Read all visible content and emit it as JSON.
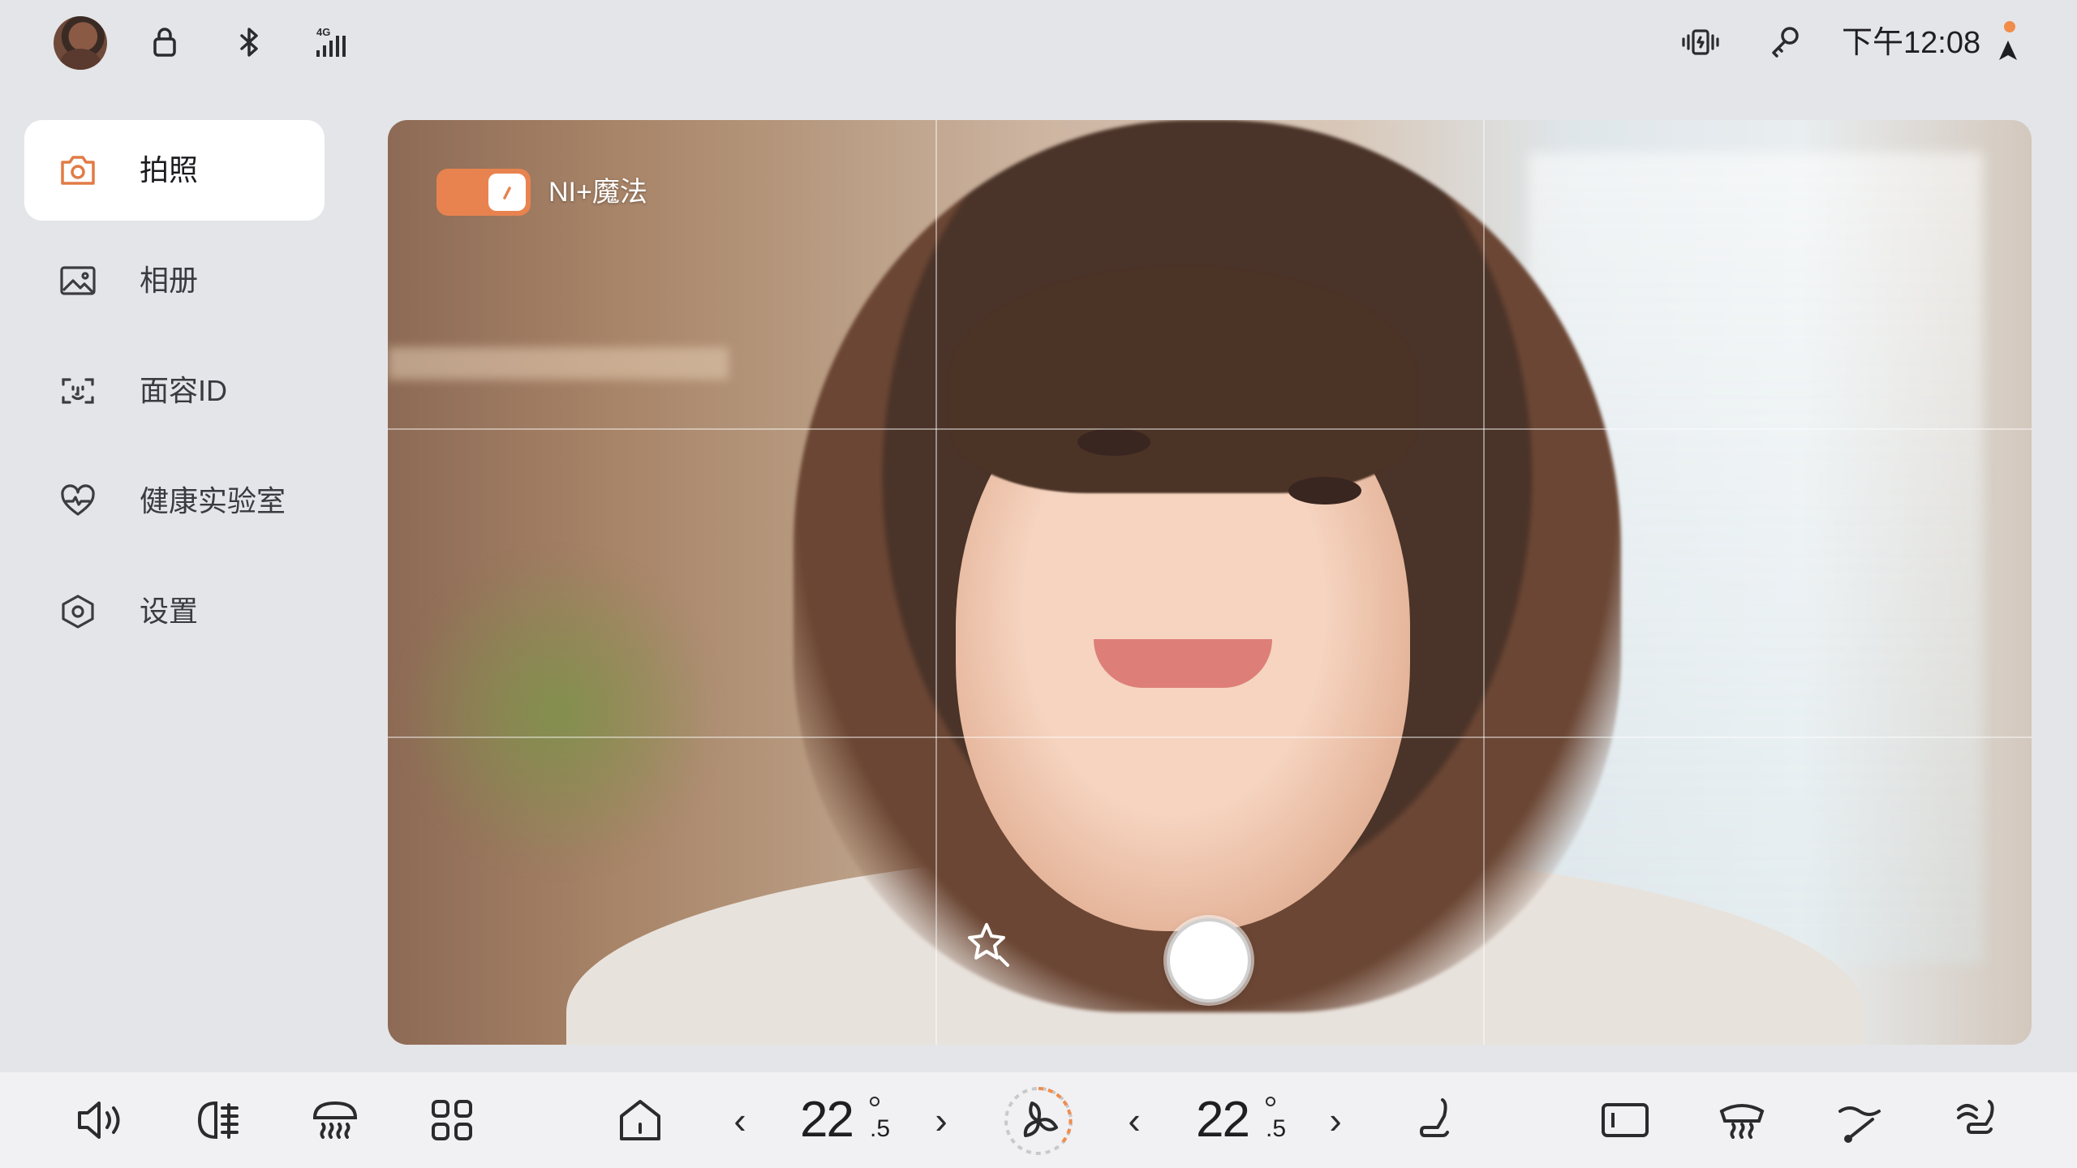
{
  "status_bar": {
    "network_label": "4G",
    "time": "下午12:08",
    "nav_marker_color": "#f28c4b"
  },
  "sidebar": {
    "items": [
      {
        "label": "拍照",
        "icon": "camera-icon",
        "active": true
      },
      {
        "label": "相册",
        "icon": "image-icon",
        "active": false
      },
      {
        "label": "面容ID",
        "icon": "face-id-icon",
        "active": false
      },
      {
        "label": "健康实验室",
        "icon": "heart-pulse-icon",
        "active": false
      },
      {
        "label": "设置",
        "icon": "settings-icon",
        "active": false
      }
    ]
  },
  "viewport": {
    "magic_toggle_label": "NI+魔法",
    "magic_toggle_on": true,
    "accent_color": "#e8834f"
  },
  "dock": {
    "left_temp": {
      "main": "22",
      "decimal": ".5"
    },
    "right_temp": {
      "main": "22",
      "decimal": ".5"
    },
    "prev_symbol": "‹",
    "next_symbol": "›",
    "fan_accent": "#f28c4b"
  }
}
